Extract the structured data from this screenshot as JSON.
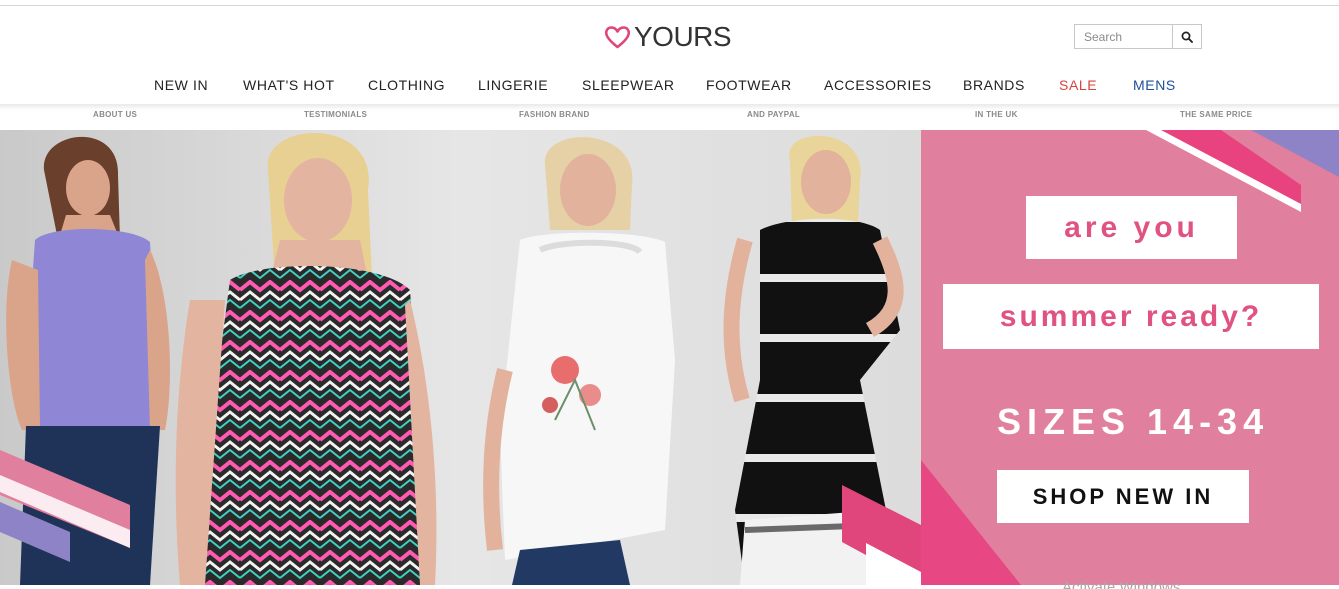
{
  "brand": {
    "logo_text": "YOURS",
    "heart_color": "#e0457b"
  },
  "search": {
    "placeholder": "Search"
  },
  "nav": [
    {
      "label": "NEW IN"
    },
    {
      "label": "WHAT'S HOT"
    },
    {
      "label": "CLOTHING"
    },
    {
      "label": "LINGERIE"
    },
    {
      "label": "SLEEPWEAR"
    },
    {
      "label": "FOOTWEAR"
    },
    {
      "label": "ACCESSORIES"
    },
    {
      "label": "BRANDS"
    },
    {
      "label": "SALE",
      "color": "#d9423d"
    },
    {
      "label": "MENS",
      "color": "#1f4f98"
    }
  ],
  "usp": [
    "ABOUT US",
    "TESTIMONIALS",
    "FASHION BRAND",
    "AND PAYPAL",
    "IN THE UK",
    "THE SAME PRICE"
  ],
  "hero": {
    "line1": "are you",
    "line2": "summer ready?",
    "sizes": "SIZES 14-34",
    "cta": "SHOP NEW IN",
    "panel_color": "#e07f9e",
    "accent_color": "#e0527f",
    "model_tops": [
      "purple vest",
      "multi-print cami",
      "white cold-shoulder tee",
      "black tie-dye dress"
    ]
  },
  "watermark": "Activate Windows"
}
